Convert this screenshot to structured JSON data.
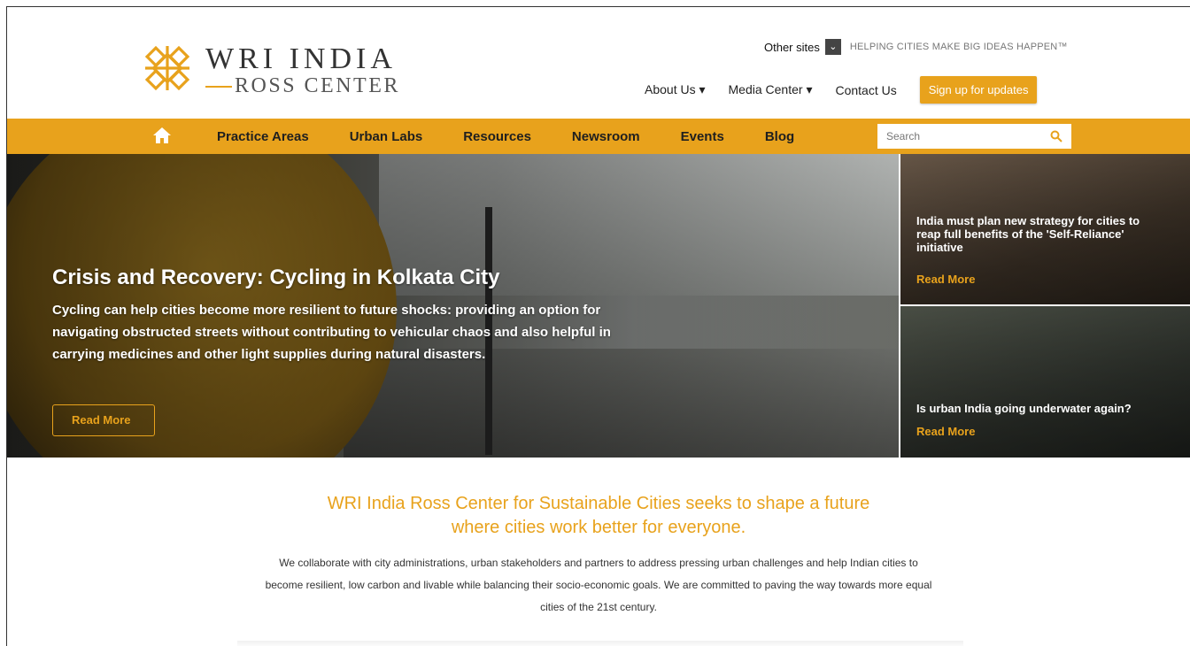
{
  "brand": {
    "title": "WRI INDIA",
    "subtitle": "ROSS CENTER",
    "accent_color": "#E8A21C"
  },
  "topbar": {
    "other_sites": "Other sites",
    "tagline": "HELPING CITIES MAKE BIG IDEAS HAPPEN™"
  },
  "utilnav": {
    "about": "About Us ▾",
    "media": "Media Center ▾",
    "contact": "Contact Us",
    "signup": "Sign up for updates"
  },
  "nav": {
    "home_icon": "home-icon",
    "items": [
      "Practice Areas",
      "Urban Labs",
      "Resources",
      "Newsroom",
      "Events",
      "Blog"
    ],
    "search_placeholder": "Search"
  },
  "hero": {
    "title": "Crisis and Recovery: Cycling in Kolkata City",
    "text": "Cycling can help cities become more resilient to future shocks: providing an option for navigating obstructed streets without contributing to vehicular chaos and also helpful in carrying medicines and other light supplies during natural disasters.",
    "button": "Read More"
  },
  "side_cards": [
    {
      "title": "India must plan new strategy for cities to reap full benefits of the 'Self-Reliance' initiative",
      "link": "Read More"
    },
    {
      "title": "Is urban India going underwater again?",
      "link": "Read More"
    }
  ],
  "intro": {
    "heading": "WRI India Ross Center for Sustainable Cities seeks to shape a future where cities work better for everyone.",
    "text": "We collaborate with city administrations, urban stakeholders and partners to address pressing urban challenges and help Indian cities to become resilient, low carbon and livable while balancing their socio-economic goals. We are committed to paving the way towards more equal cities of the 21st century."
  }
}
